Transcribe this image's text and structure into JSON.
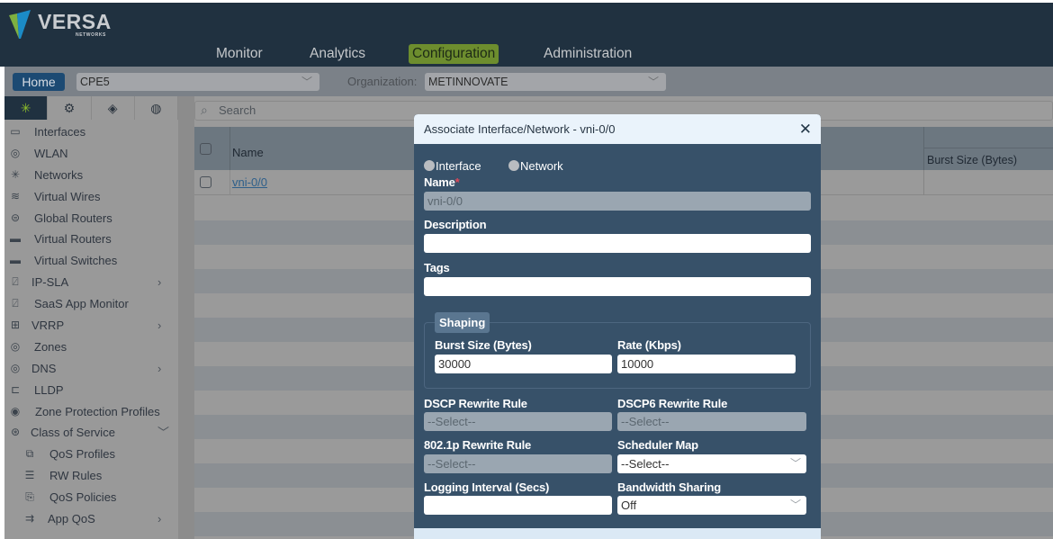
{
  "app": {
    "brand": "VERSA",
    "brand_sub": "NETWORKS",
    "nav": [
      {
        "label": "Monitor",
        "active": false
      },
      {
        "label": "Analytics",
        "active": false
      },
      {
        "label": "Configuration",
        "active": true
      },
      {
        "label": "Administration",
        "active": false
      }
    ]
  },
  "context": {
    "home_label": "Home",
    "appliance": "CPE5",
    "org_label": "Organization:",
    "org_value": "METINNOVATE"
  },
  "sidebar": {
    "tabs": [
      {
        "icon": "network-icon",
        "active": true
      },
      {
        "icon": "gear-icon",
        "active": false
      },
      {
        "icon": "cube-icon",
        "active": false
      },
      {
        "icon": "globe-settings-icon",
        "active": false
      }
    ],
    "items": [
      {
        "label": "Interfaces",
        "icon": "interface-icon"
      },
      {
        "label": "WLAN",
        "icon": "wireless-icon"
      },
      {
        "label": "Networks",
        "icon": "network-icon"
      },
      {
        "label": "Virtual Wires",
        "icon": "wire-icon"
      },
      {
        "label": "Global Routers",
        "icon": "router-icon"
      },
      {
        "label": "Virtual Routers",
        "icon": "router-icon"
      },
      {
        "label": "Virtual Switches",
        "icon": "switch-icon"
      },
      {
        "label": "IP-SLA",
        "icon": "monitor-icon",
        "expandable": true
      },
      {
        "label": "SaaS App Monitor",
        "icon": "monitor-icon"
      },
      {
        "label": "VRRP",
        "icon": "vrrp-icon",
        "expandable": true
      },
      {
        "label": "Zones",
        "icon": "zone-icon"
      },
      {
        "label": "DNS",
        "icon": "dns-icon",
        "expandable": true
      },
      {
        "label": "LLDP",
        "icon": "lldp-icon"
      },
      {
        "label": "Zone Protection Profiles",
        "icon": "zone-protection-icon"
      },
      {
        "label": "Class of Service",
        "icon": "cos-icon",
        "expanded": true
      },
      {
        "label": "QoS Profiles",
        "icon": "qos-profile-icon",
        "sub": true
      },
      {
        "label": "RW Rules",
        "icon": "rw-rules-icon",
        "sub": true
      },
      {
        "label": "QoS Policies",
        "icon": "qos-policy-icon",
        "sub": true
      },
      {
        "label": "App QoS",
        "icon": "app-qos-icon",
        "sub": true,
        "expandable": true
      }
    ]
  },
  "table": {
    "search_placeholder": "Search",
    "columns": [
      "Name",
      "Burst Size (Bytes)"
    ],
    "rows": [
      {
        "name": "vni-0/0",
        "burst_size": ""
      }
    ]
  },
  "modal": {
    "title": "Associate Interface/Network - vni-0/0",
    "close_label": "✕",
    "radio_options": [
      "Interface",
      "Network"
    ],
    "name_label": "Name",
    "name_value": "vni-0/0",
    "description_label": "Description",
    "description_value": "",
    "tags_label": "Tags",
    "tags_value": "",
    "shaping": {
      "legend": "Shaping",
      "burst_label": "Burst Size (Bytes)",
      "burst_value": "30000",
      "rate_label": "Rate (Kbps)",
      "rate_value": "10000"
    },
    "dscp_label": "DSCP Rewrite Rule",
    "dscp_value": "--Select--",
    "dscp6_label": "DSCP6 Rewrite Rule",
    "dscp6_value": "--Select--",
    "dot1p_label": "802.1p Rewrite Rule",
    "dot1p_value": "--Select--",
    "scheduler_label": "Scheduler Map",
    "scheduler_value": "--Select--",
    "logging_label": "Logging Interval (Secs)",
    "logging_value": "",
    "bandwidth_label": "Bandwidth Sharing",
    "bandwidth_value": "Off"
  }
}
